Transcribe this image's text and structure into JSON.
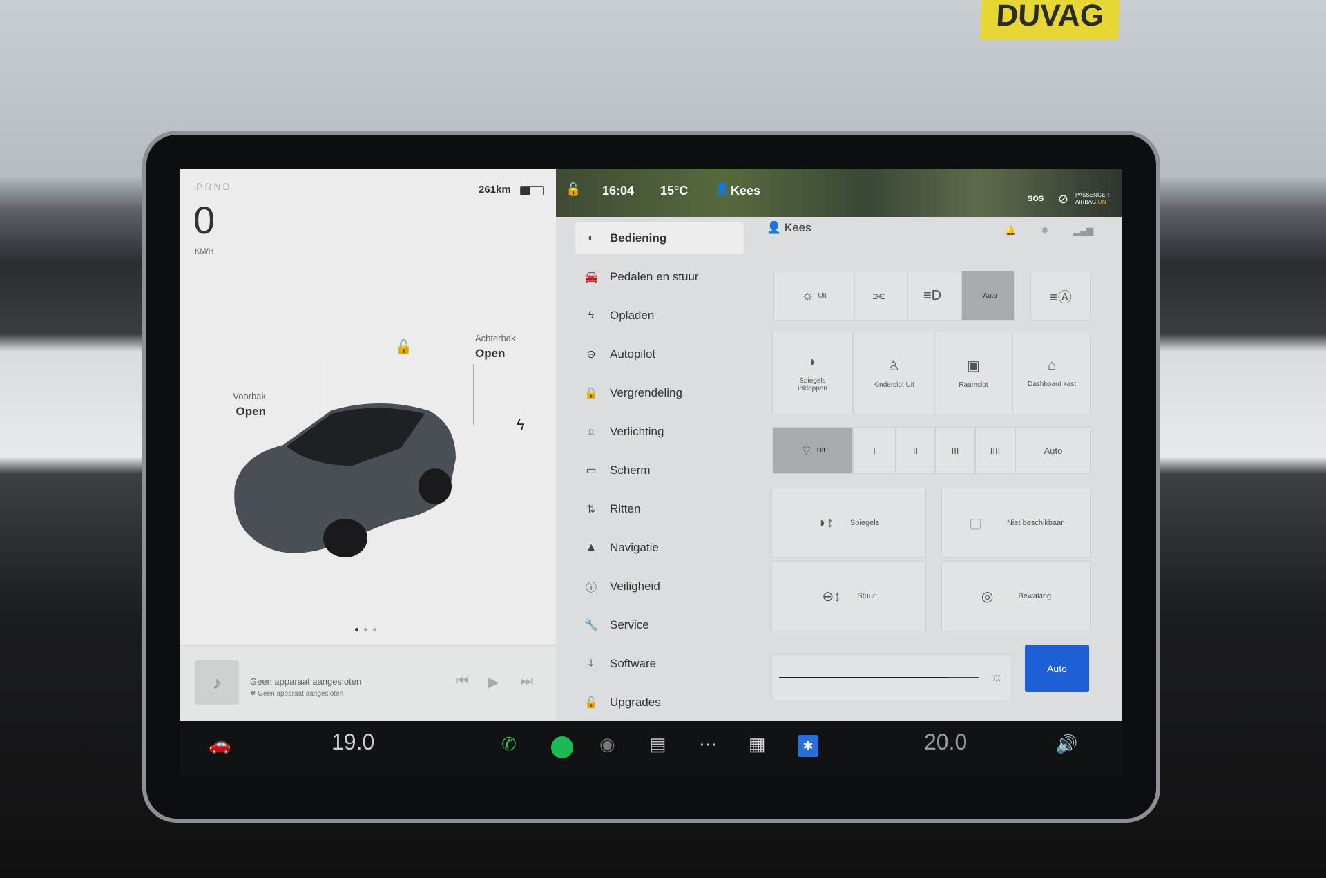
{
  "background": {
    "sign": "DUVAG"
  },
  "status_bar": {
    "time": "16:04",
    "temperature": "15°C",
    "user": "Kees",
    "sos": "SOS",
    "airbag_line1": "PASSENGER",
    "airbag_line2": "AIRBAG",
    "airbag_state": "ON"
  },
  "car_panel": {
    "gear": "PRND",
    "speed": "0",
    "speed_unit": "KM/H",
    "range": "261km",
    "battery_level_pct": 45,
    "trunk_label": "Achterbak",
    "trunk_state": "Open",
    "frunk_label": "Voorbak",
    "frunk_state": "Open",
    "page_count": 3,
    "active_page": 1
  },
  "media": {
    "title": "Geen apparaat aangesloten",
    "subtitle": "Geen apparaat aangesloten"
  },
  "menu": {
    "items": [
      {
        "label": "Bediening",
        "icon": "toggle-icon",
        "glyph": "◐",
        "active": true
      },
      {
        "label": "Pedalen en stuur",
        "icon": "car-icon",
        "glyph": "🚘"
      },
      {
        "label": "Opladen",
        "icon": "bolt-icon",
        "glyph": "ϟ"
      },
      {
        "label": "Autopilot",
        "icon": "steering-wheel-icon",
        "glyph": "⊖"
      },
      {
        "label": "Vergrendeling",
        "icon": "lock-icon",
        "glyph": "🔒"
      },
      {
        "label": "Verlichting",
        "icon": "light-icon",
        "glyph": "☼"
      },
      {
        "label": "Scherm",
        "icon": "screen-icon",
        "glyph": "▭"
      },
      {
        "label": "Ritten",
        "icon": "trips-icon",
        "glyph": "⇅"
      },
      {
        "label": "Navigatie",
        "icon": "navigation-icon",
        "glyph": "▲"
      },
      {
        "label": "Veiligheid",
        "icon": "safety-icon",
        "glyph": "ⓘ"
      },
      {
        "label": "Service",
        "icon": "wrench-icon",
        "glyph": "🔧"
      },
      {
        "label": "Software",
        "icon": "download-icon",
        "glyph": "⤓"
      },
      {
        "label": "Upgrades",
        "icon": "bag-icon",
        "glyph": "🔓"
      }
    ]
  },
  "controls": {
    "user": "Kees",
    "lights": [
      {
        "label": "Uit",
        "glyph": "☼"
      },
      {
        "label": "",
        "glyph": "⫘"
      },
      {
        "label": "",
        "glyph": "≡D"
      },
      {
        "label": "Auto",
        "glyph": "",
        "active": true
      }
    ],
    "auto_high_beam_glyph": "≡Ⓐ",
    "tiles": [
      {
        "label": "Spiegels inklappen",
        "glyph": "◗"
      },
      {
        "label": "Kinderslot Uit",
        "glyph": "♙"
      },
      {
        "label": "Raamslot",
        "glyph": "▣"
      },
      {
        "label": "Dashboard kast",
        "glyph": "⌂"
      }
    ],
    "wipers": [
      {
        "label": "Uit",
        "glyph": "⌔",
        "active": true
      },
      {
        "label": "I"
      },
      {
        "label": "II"
      },
      {
        "label": "III"
      },
      {
        "label": "IIII"
      },
      {
        "label": "Auto"
      }
    ],
    "mirrors": "Spiegels",
    "steering": "Stuur",
    "unavailable": "Niet beschikbaar",
    "sentry": "Bewaking",
    "brightness_auto": "Auto",
    "brightness_level_pct": 85
  },
  "bottom_bar": {
    "driver_temp": "19.0",
    "passenger_temp": "20.0"
  },
  "colors": {
    "accent": "#1f5fd6",
    "spotify": "#1db954",
    "phone": "#2ec24a"
  }
}
